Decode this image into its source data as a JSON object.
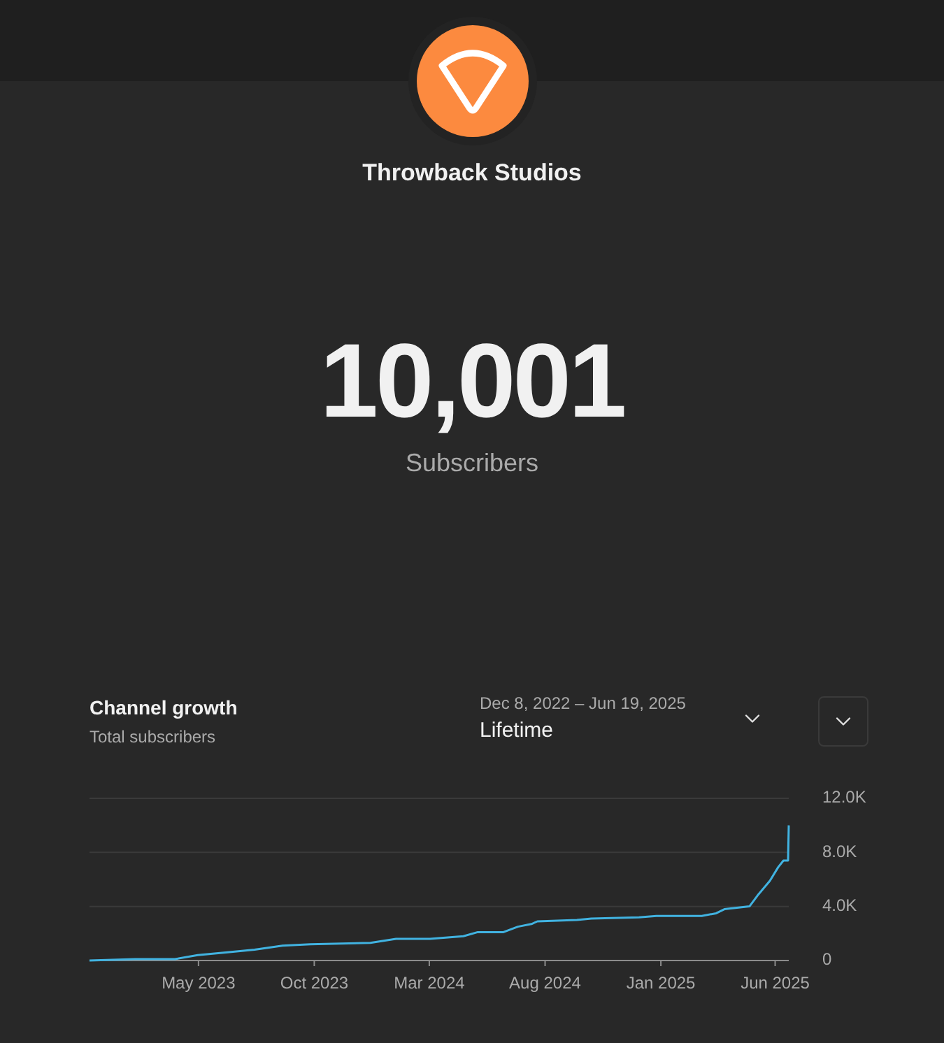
{
  "header": {
    "channel_name": "Throwback Studios"
  },
  "subscribers": {
    "count": "10,001",
    "label": "Subscribers"
  },
  "growth": {
    "title": "Channel growth",
    "subtitle": "Total subscribers",
    "date_range": "Dec 8, 2022 – Jun 19, 2025",
    "period": "Lifetime",
    "chart_data": {
      "type": "line",
      "x": [
        "2022-12-08",
        "2023-02-06",
        "2023-03-31",
        "2023-04-30",
        "2023-06-06",
        "2023-07-14",
        "2023-08-20",
        "2023-09-26",
        "2023-12-14",
        "2024-01-17",
        "2024-03-02",
        "2024-04-15",
        "2024-05-04",
        "2024-06-07",
        "2024-06-26",
        "2024-07-14",
        "2024-07-22",
        "2024-09-12",
        "2024-10-01",
        "2024-12-03",
        "2024-12-26",
        "2025-02-24",
        "2025-03-15",
        "2025-03-26",
        "2025-04-28",
        "2025-05-10",
        "2025-05-25",
        "2025-06-05",
        "2025-06-12",
        "2025-06-18",
        "2025-06-19"
      ],
      "series": [
        {
          "color": "#41b3e1",
          "values": [
            0,
            100,
            100,
            400,
            600,
            800,
            1100,
            1200,
            1300,
            1600,
            1600,
            1800,
            2100,
            2100,
            2500,
            2700,
            2900,
            3000,
            3100,
            3200,
            3300,
            3300,
            3500,
            3800,
            4000,
            4900,
            5900,
            6900,
            7400,
            7400,
            10000
          ]
        }
      ],
      "xlim": [
        "2022-12-08",
        "2025-06-19"
      ],
      "ylim": [
        0,
        12000
      ],
      "xticks": [
        {
          "value": "2023-05-01",
          "label": "May 2023"
        },
        {
          "value": "2023-10-01",
          "label": "Oct 2023"
        },
        {
          "value": "2024-03-01",
          "label": "Mar 2024"
        },
        {
          "value": "2024-08-01",
          "label": "Aug 2024"
        },
        {
          "value": "2025-01-01",
          "label": "Jan 2025"
        },
        {
          "value": "2025-06-01",
          "label": "Jun 2025"
        }
      ],
      "yticks": [
        {
          "value": 0,
          "label": "0"
        },
        {
          "value": 4000,
          "label": "4.0K"
        },
        {
          "value": 8000,
          "label": "8.0K"
        },
        {
          "value": 12000,
          "label": "12.0K"
        }
      ]
    }
  }
}
